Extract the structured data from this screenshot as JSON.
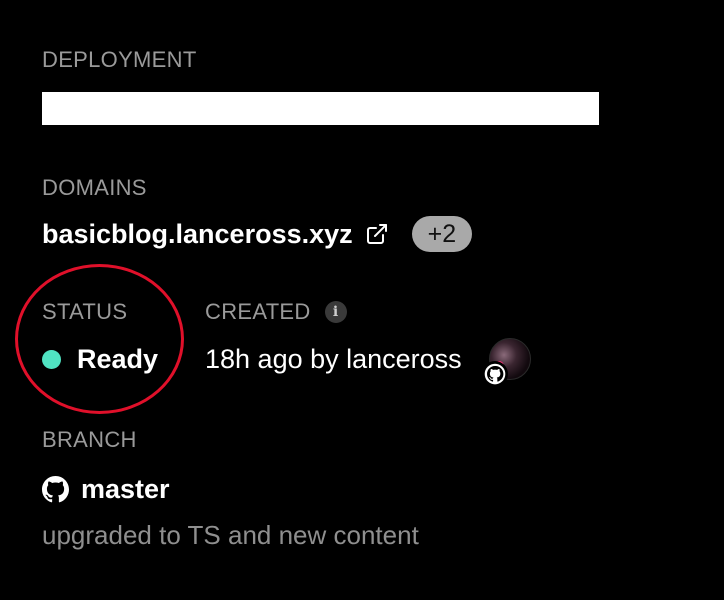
{
  "deployment": {
    "label": "DEPLOYMENT"
  },
  "domains": {
    "label": "DOMAINS",
    "primary": "basicblog.lanceross.xyz",
    "extra_count": "+2",
    "link_icon": "external-link-icon"
  },
  "status": {
    "label": "STATUS",
    "value": "Ready",
    "dot_color": "#50e3c2",
    "highlight_color": "#e0102a"
  },
  "created": {
    "label": "CREATED",
    "info_glyph": "i",
    "value": "18h ago by lanceross",
    "avatar_icon": "user-avatar",
    "source_icon": "github-icon"
  },
  "branch": {
    "label": "BRANCH",
    "name": "master",
    "icon": "github-icon",
    "commit_message": "upgraded to TS and new content"
  }
}
